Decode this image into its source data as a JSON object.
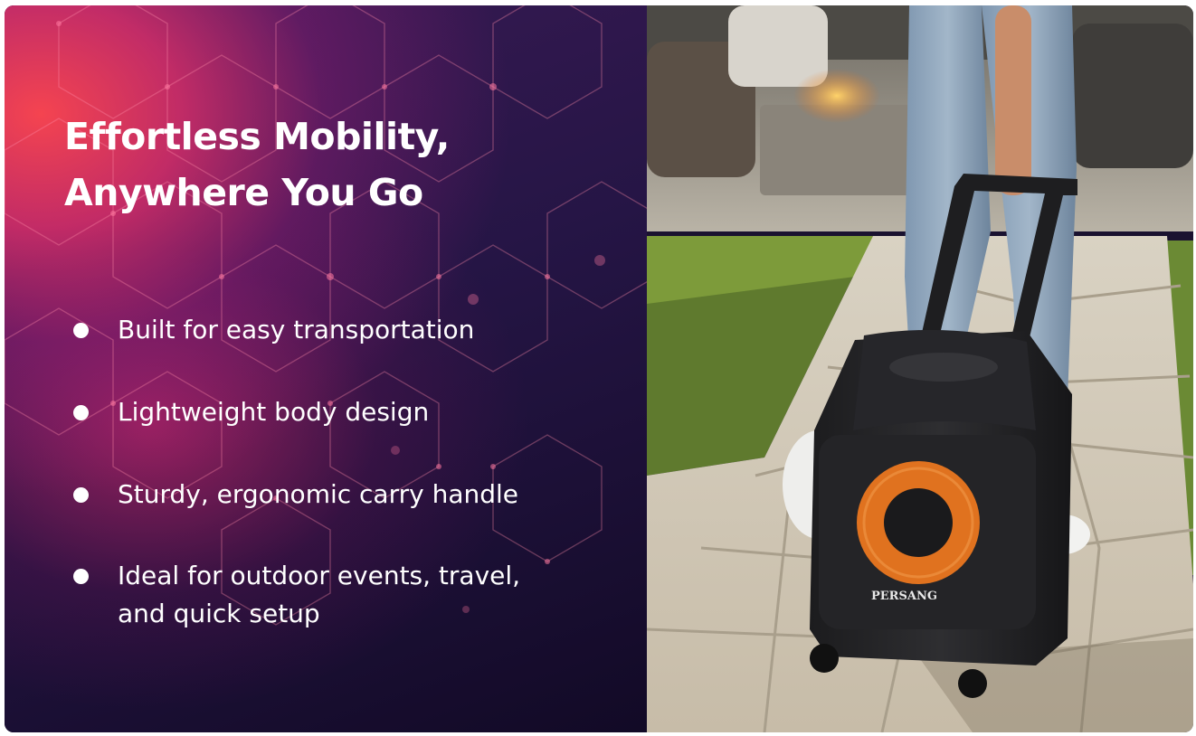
{
  "headline": {
    "line1": "Effortless Mobility,",
    "line2": "Anywhere You Go"
  },
  "features": [
    {
      "line1": "Built for easy transportation",
      "line2": ""
    },
    {
      "line1": "Lightweight body design",
      "line2": ""
    },
    {
      "line1": "Sturdy, ergonomic carry handle",
      "line2": ""
    },
    {
      "line1": "Ideal for outdoor events, travel,",
      "line2": "and quick setup"
    }
  ],
  "photo": {
    "brand_logo": "PERSANG"
  },
  "colors": {
    "left_background": "#251545",
    "glow": "#ff4650",
    "text": "#ffffff",
    "speaker_ring": "#e0721f"
  }
}
